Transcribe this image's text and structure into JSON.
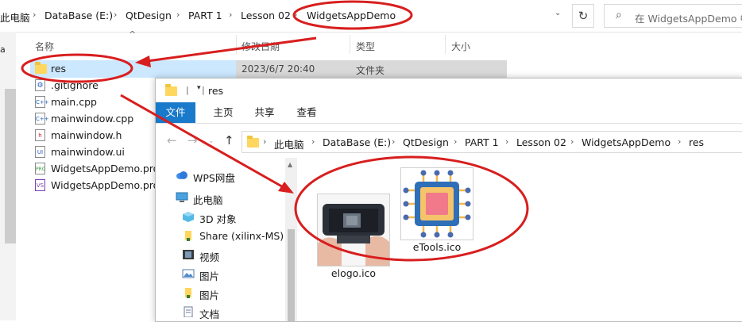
{
  "back_window": {
    "breadcrumbs": [
      "此电脑",
      "DataBase (E:)",
      "QtDesign",
      "PART 1",
      "Lesson 02",
      "WidgetsAppDemo"
    ],
    "search_placeholder": "在 WidgetsAppDemo 中",
    "columns": {
      "name": "名称",
      "modified": "修改日期",
      "type": "类型",
      "size": "大小"
    },
    "side_letter": "a",
    "files": [
      {
        "name": "res",
        "icon": "folder-icon",
        "modified": "2023/6/7 20:40",
        "type": "文件夹"
      },
      {
        "name": ".gitignore",
        "icon": "gear-file-icon"
      },
      {
        "name": "main.cpp",
        "icon": "cpp-file-icon",
        "glyph": "C++"
      },
      {
        "name": "mainwindow.cpp",
        "icon": "cpp-file-icon",
        "glyph": "C++"
      },
      {
        "name": "mainwindow.h",
        "icon": "header-file-icon",
        "glyph": "h"
      },
      {
        "name": "mainwindow.ui",
        "icon": "ui-file-icon",
        "glyph": "UI"
      },
      {
        "name": "WidgetsAppDemo.pro",
        "icon": "pro-file-icon",
        "glyph": "PRO"
      },
      {
        "name": "WidgetsAppDemo.pro",
        "icon": "vs-file-icon",
        "glyph": "VS"
      }
    ]
  },
  "front_window": {
    "title": "res",
    "ribbon_tabs": [
      "文件",
      "主页",
      "共享",
      "查看"
    ],
    "breadcrumbs": [
      "此电脑",
      "DataBase (E:)",
      "QtDesign",
      "PART 1",
      "Lesson 02",
      "WidgetsAppDemo",
      "res"
    ],
    "nav_items": [
      {
        "label": "WPS网盘",
        "icon": "cloud-icon"
      },
      {
        "label": "此电脑",
        "icon": "computer-icon"
      },
      {
        "label": "3D 对象",
        "icon": "cube-icon"
      },
      {
        "label": "Share (xilinx-MS)",
        "icon": "folder-icon"
      },
      {
        "label": "视频",
        "icon": "video-icon"
      },
      {
        "label": "图片",
        "icon": "picture-icon"
      },
      {
        "label": "图片",
        "icon": "folder-icon"
      },
      {
        "label": "文档",
        "icon": "document-icon"
      }
    ],
    "files": [
      {
        "name": "elogo.ico",
        "icon": "image-thumbnail"
      },
      {
        "name": "eTools.ico",
        "icon": "chip-thumbnail"
      }
    ]
  },
  "colors": {
    "annotation": "#d81e1e",
    "selection": "#cce8ff",
    "ribbon_active": "#1979ca",
    "folder": "#ffd75e"
  }
}
